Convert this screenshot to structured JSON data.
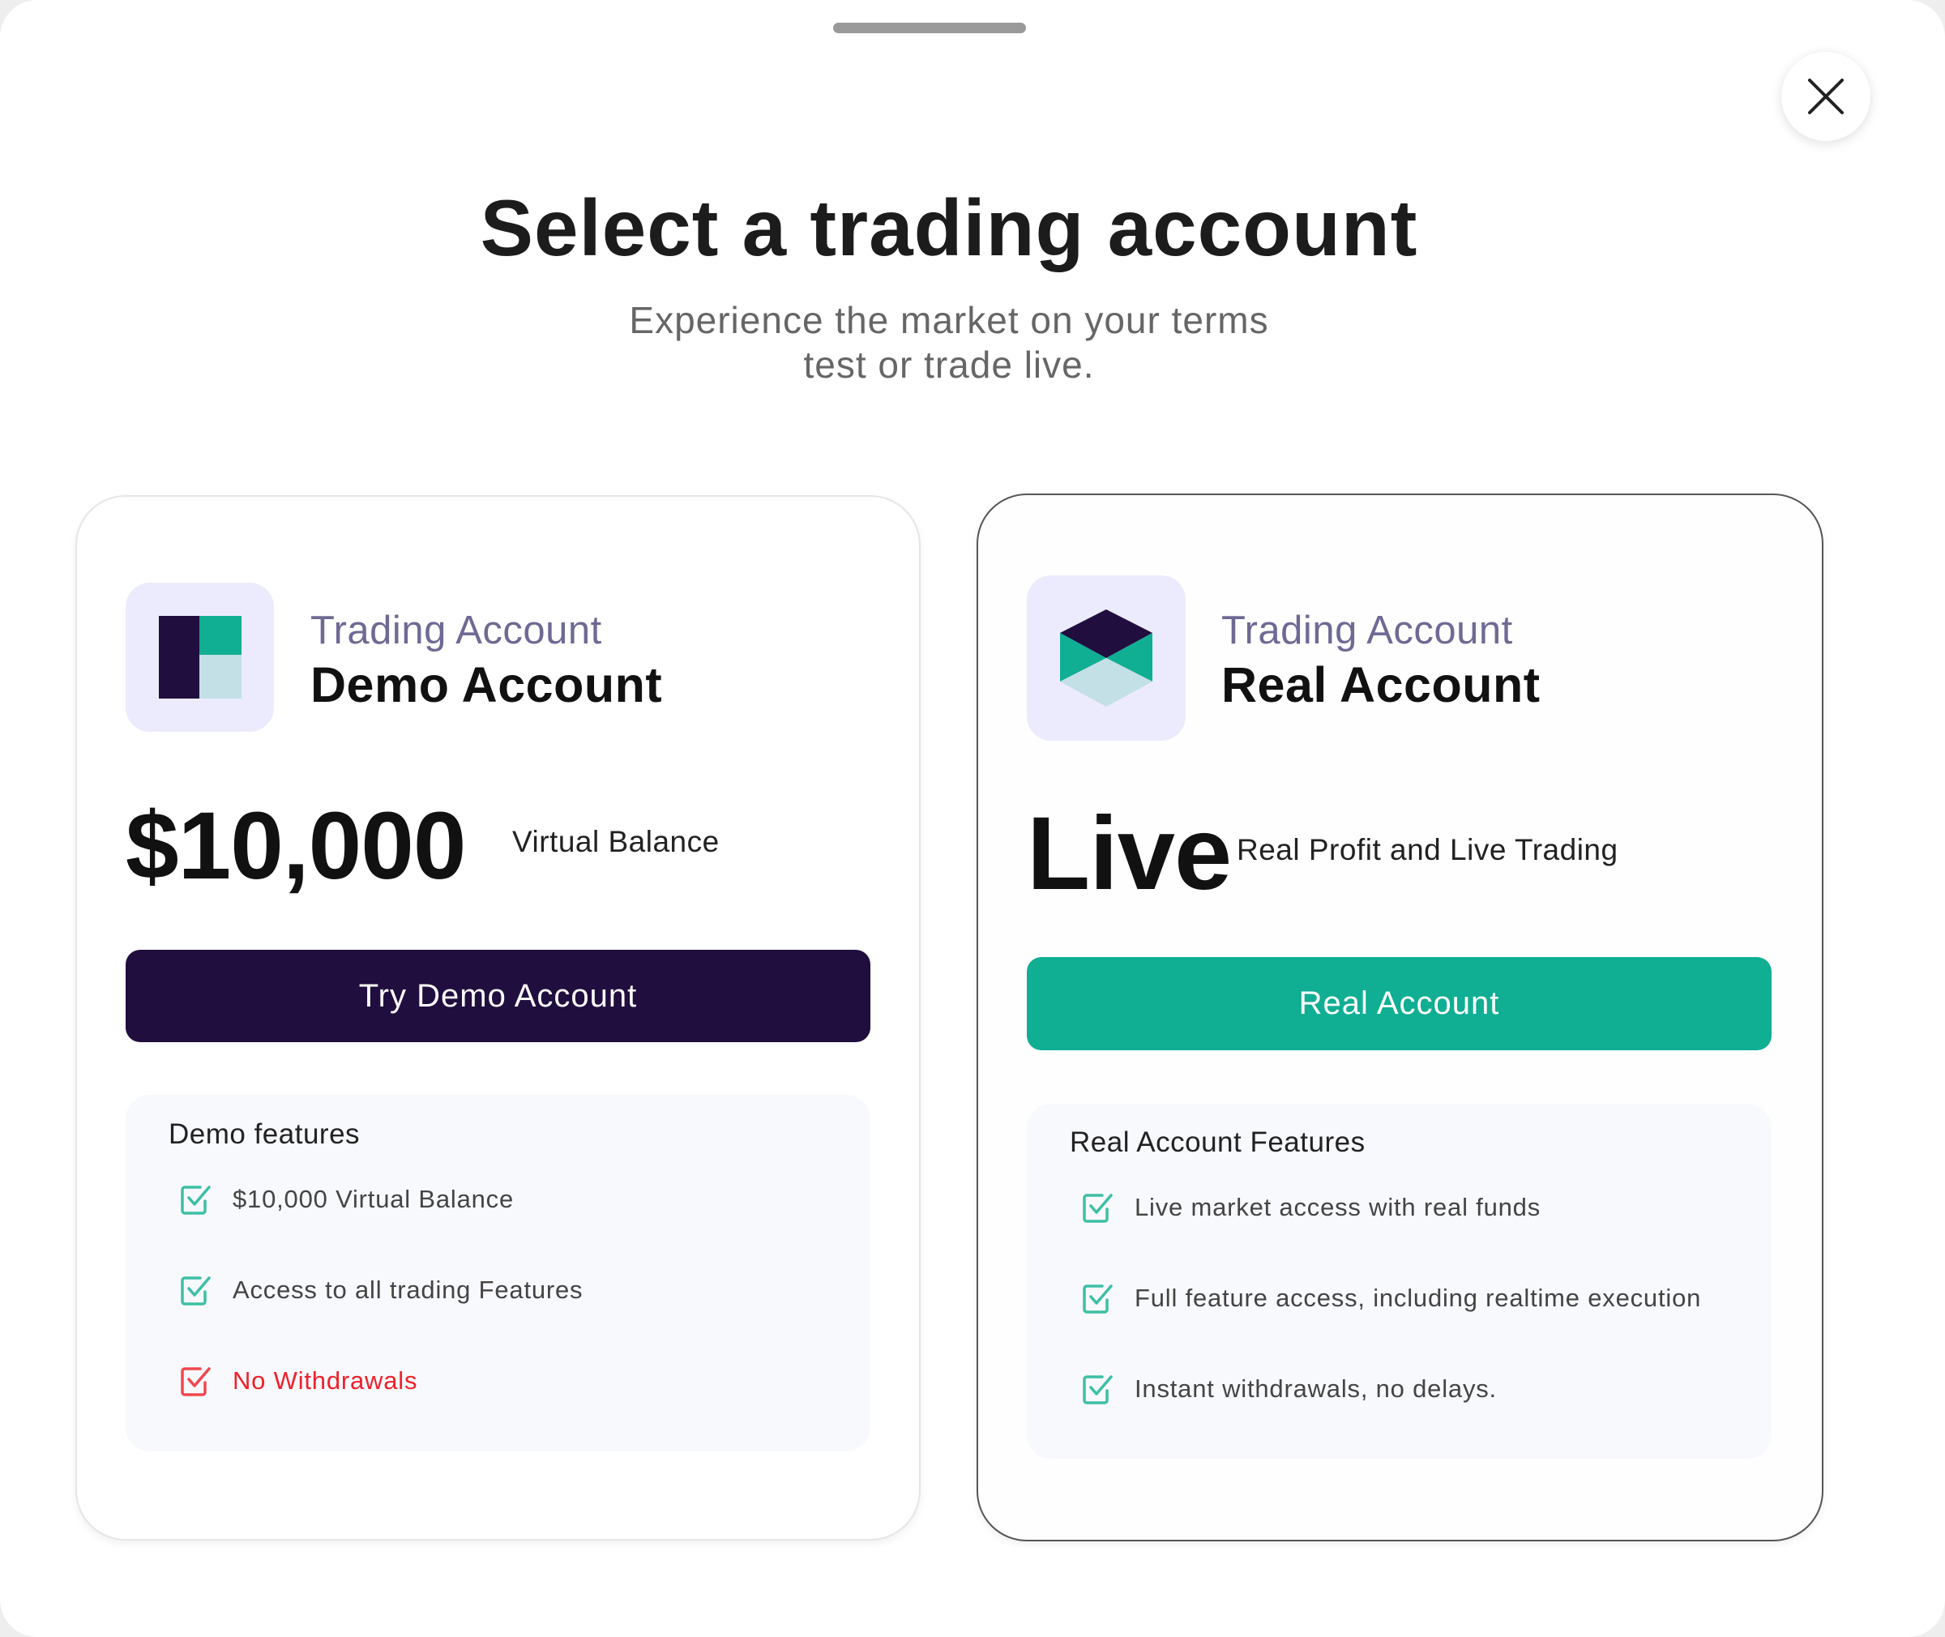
{
  "header": {
    "title": "Select a trading account",
    "subtitle_line1": "Experience the market on your terms",
    "subtitle_line2": "test or trade live."
  },
  "demo": {
    "kicker": "Trading Account",
    "name": "Demo Account",
    "amount": "$10,000",
    "amount_note": "Virtual Balance",
    "button_label": "Try Demo Account",
    "features_title": "Demo features",
    "features": [
      {
        "label": "$10,000 Virtual Balance",
        "type": "positive"
      },
      {
        "label": "Access to all trading Features",
        "type": "positive"
      },
      {
        "label": "No Withdrawals",
        "type": "negative"
      }
    ]
  },
  "real": {
    "kicker": "Trading Account",
    "name": "Real Account",
    "amount": "Live",
    "amount_note": "Real Profit and Live Trading",
    "button_label": "Real Account",
    "features_title": "Real Account Features",
    "features": [
      {
        "label": "Live market access with real funds",
        "type": "positive"
      },
      {
        "label": "Full feature access, including realtime execution",
        "type": "positive"
      },
      {
        "label": "Instant withdrawals, no delays.",
        "type": "positive"
      }
    ]
  },
  "colors": {
    "navy": "#200e3f",
    "teal": "#10ae93",
    "light_teal": "#c2e0e6",
    "negative": "#f0202a",
    "icon_bg": "#ecebfd"
  }
}
